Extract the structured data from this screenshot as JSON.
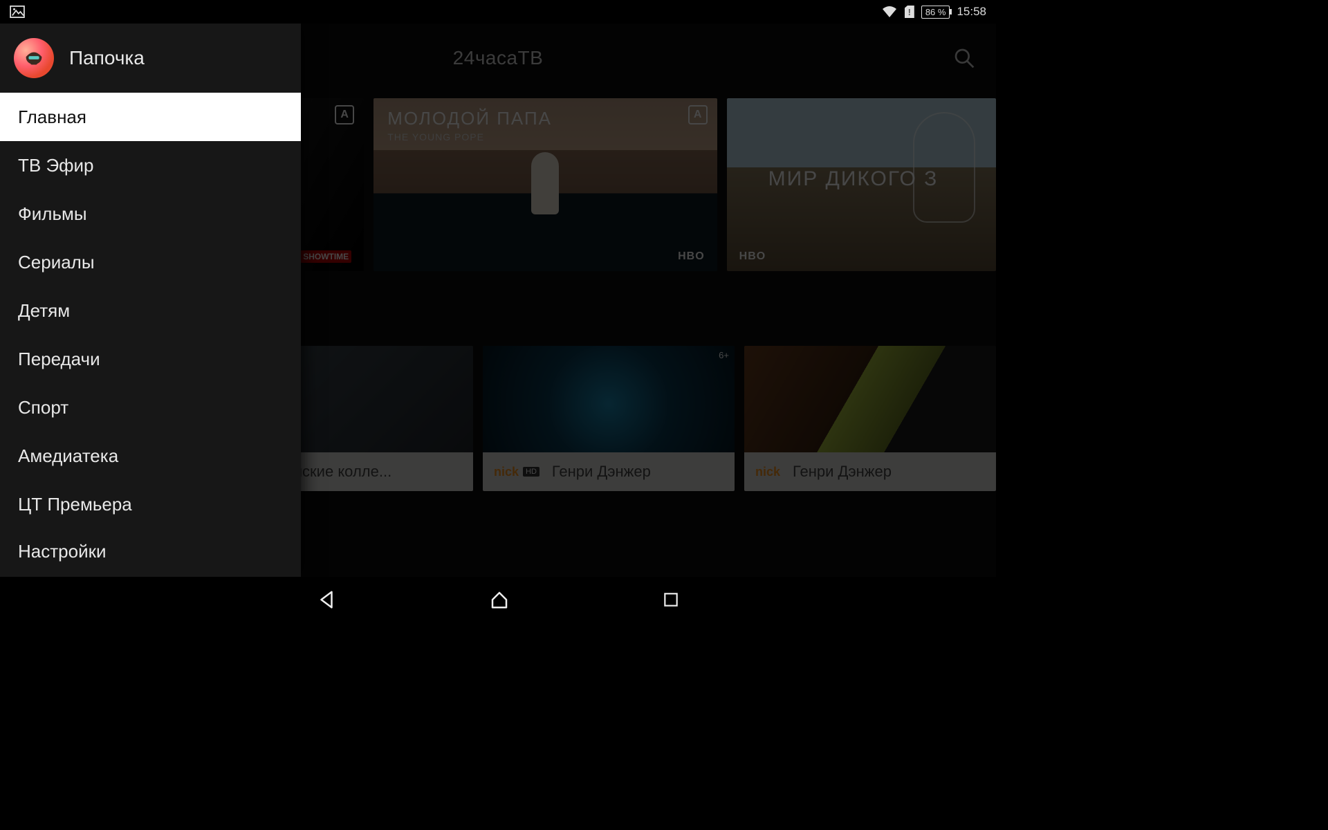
{
  "status": {
    "battery": "86 %",
    "time": "15:58"
  },
  "appbar": {
    "title": "24часаТВ"
  },
  "user": {
    "name": "Папочка"
  },
  "menu": [
    {
      "label": "Главная",
      "active": true
    },
    {
      "label": "ТВ Эфир",
      "active": false
    },
    {
      "label": "Фильмы",
      "active": false
    },
    {
      "label": "Сериалы",
      "active": false
    },
    {
      "label": "Детям",
      "active": false
    },
    {
      "label": "Передачи",
      "active": false
    },
    {
      "label": "Спорт",
      "active": false
    },
    {
      "label": "Амедиатека",
      "active": false
    },
    {
      "label": "ЦТ Премьера",
      "active": false
    },
    {
      "label": "Настройки",
      "active": false
    }
  ],
  "hero": {
    "left": {
      "brand": "SHOWTIME"
    },
    "center": {
      "title": "МОЛОДОЙ ПАПА",
      "subtitle": "THE YOUNG POPE",
      "brand": "HBO",
      "corner": "A"
    },
    "right": {
      "title": "МИР ДИКОГО З",
      "brand": "HBO"
    }
  },
  "row2_tiles": [
    {
      "label": "Американские колле...",
      "channel": ""
    },
    {
      "label": "Генри Дэнжер",
      "channel": "nick",
      "channel_suffix": "HD",
      "age": "6+"
    },
    {
      "label": "Генри Дэнжер",
      "channel": "nick"
    }
  ]
}
